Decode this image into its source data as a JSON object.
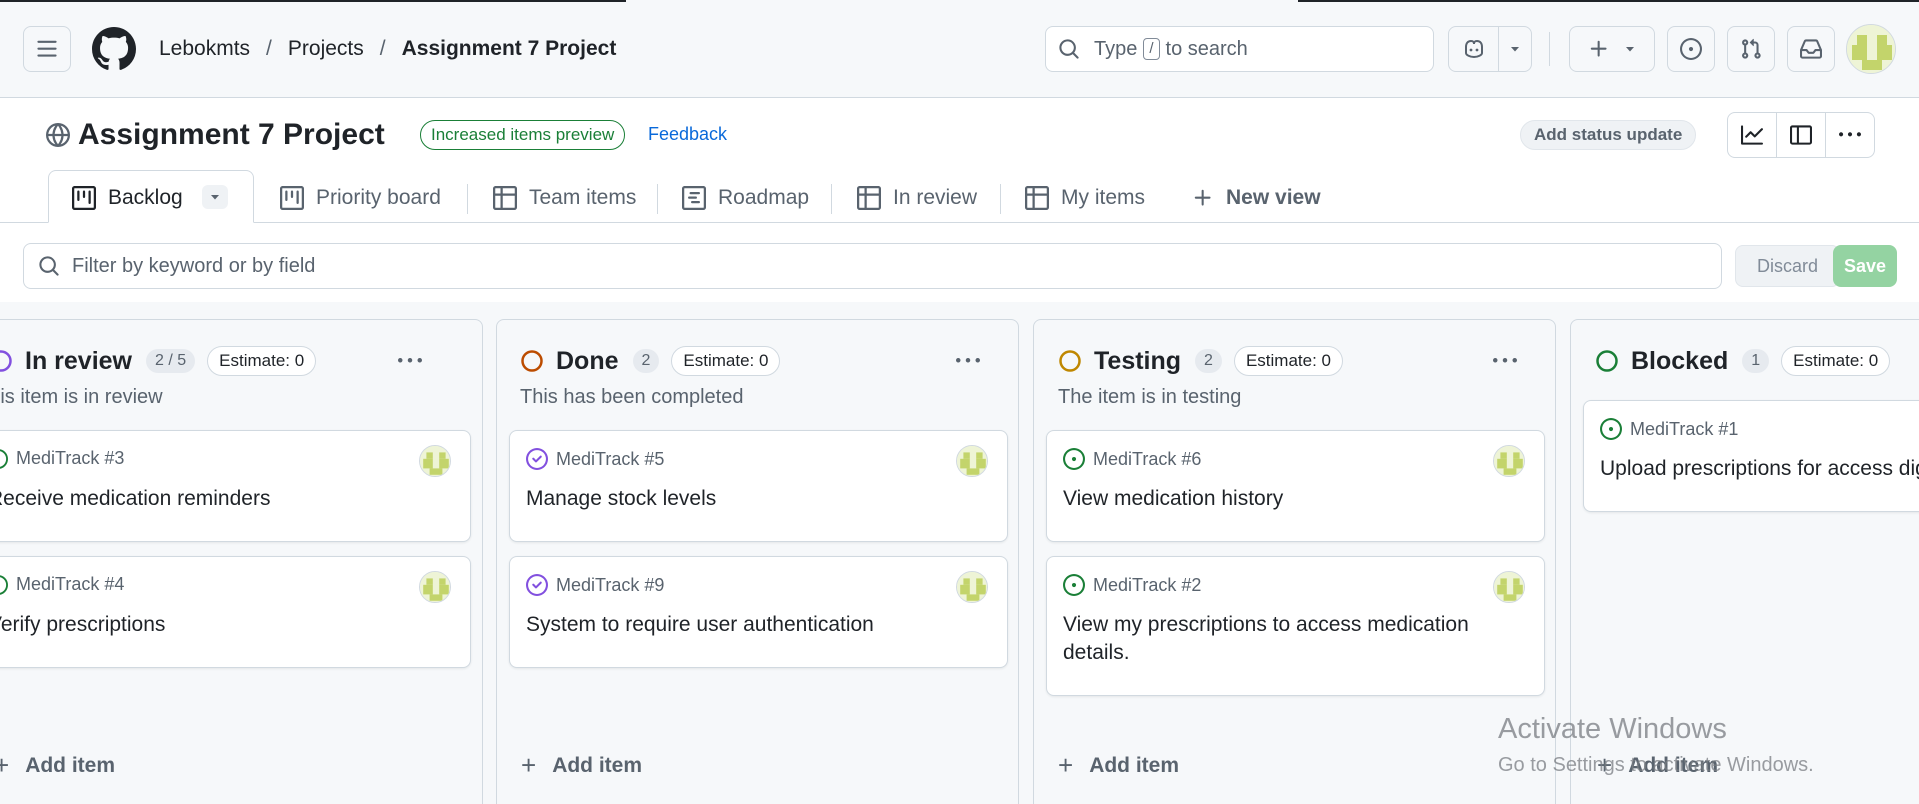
{
  "header": {
    "breadcrumbs": [
      "Lebokmts",
      "Projects",
      "Assignment 7 Project"
    ],
    "search": {
      "prefix": "Type",
      "key": "/",
      "suffix": "to search"
    }
  },
  "project": {
    "title": "Assignment 7 Project",
    "preview_badge": "Increased items preview",
    "feedback_link": "Feedback",
    "status_update_button": "Add status update"
  },
  "views": {
    "tabs": [
      "Backlog",
      "Priority board",
      "Team items",
      "Roadmap",
      "In review",
      "My items"
    ],
    "new_view": "New view",
    "active": "Backlog"
  },
  "filter": {
    "placeholder": "Filter by keyword or by field",
    "discard": "Discard",
    "save": "Save"
  },
  "board": {
    "add_item_label": "Add item",
    "columns": [
      {
        "name": "In review",
        "count": "2 / 5",
        "estimate": "Estimate: 0",
        "description": "This item is in review",
        "status_color": "#8250df",
        "cards": [
          {
            "ref": "MediTrack #3",
            "title": "Receive medication reminders",
            "state": "open"
          },
          {
            "ref": "MediTrack #4",
            "title": "Verify prescriptions",
            "state": "open"
          }
        ]
      },
      {
        "name": "Done",
        "count": "2",
        "estimate": "Estimate: 0",
        "description": "This has been completed",
        "status_color": "#bc4c00",
        "cards": [
          {
            "ref": "MediTrack #5",
            "title": "Manage stock levels",
            "state": "closed"
          },
          {
            "ref": "MediTrack #9",
            "title": "System to require user authentication",
            "state": "closed"
          }
        ]
      },
      {
        "name": "Testing",
        "count": "2",
        "estimate": "Estimate: 0",
        "description": "The item is in testing",
        "status_color": "#bf8700",
        "cards": [
          {
            "ref": "MediTrack #6",
            "title": "View medication history",
            "state": "open"
          },
          {
            "ref": "MediTrack #2",
            "title": "View my prescriptions to access medication details.",
            "state": "open"
          }
        ]
      },
      {
        "name": "Blocked",
        "count": "1",
        "estimate": "Estimate: 0",
        "description": "",
        "status_color": "#1a7f37",
        "cards": [
          {
            "ref": "MediTrack #1",
            "title": "Upload prescriptions for access digitally",
            "state": "open"
          }
        ]
      }
    ]
  },
  "watermark": {
    "line1": "Activate Windows",
    "line2": "Go to Settings to activate Windows."
  },
  "colors": {
    "open_issue": "#1a7f37",
    "closed_issue": "#8250df",
    "link": "#0969da",
    "save_disabled": "#94d3a2"
  },
  "icons": {
    "menu": "hamburger-icon",
    "logo": "github-logo-icon",
    "search": "search-icon",
    "copilot": "copilot-icon",
    "create": "plus-icon",
    "issues": "issue-opened-icon",
    "pulls": "git-pull-request-icon",
    "inbox": "inbox-icon",
    "globe": "globe-icon",
    "insights": "graph-icon",
    "side_panel": "sidebar-expand-icon",
    "more": "kebab-horizontal-icon"
  }
}
